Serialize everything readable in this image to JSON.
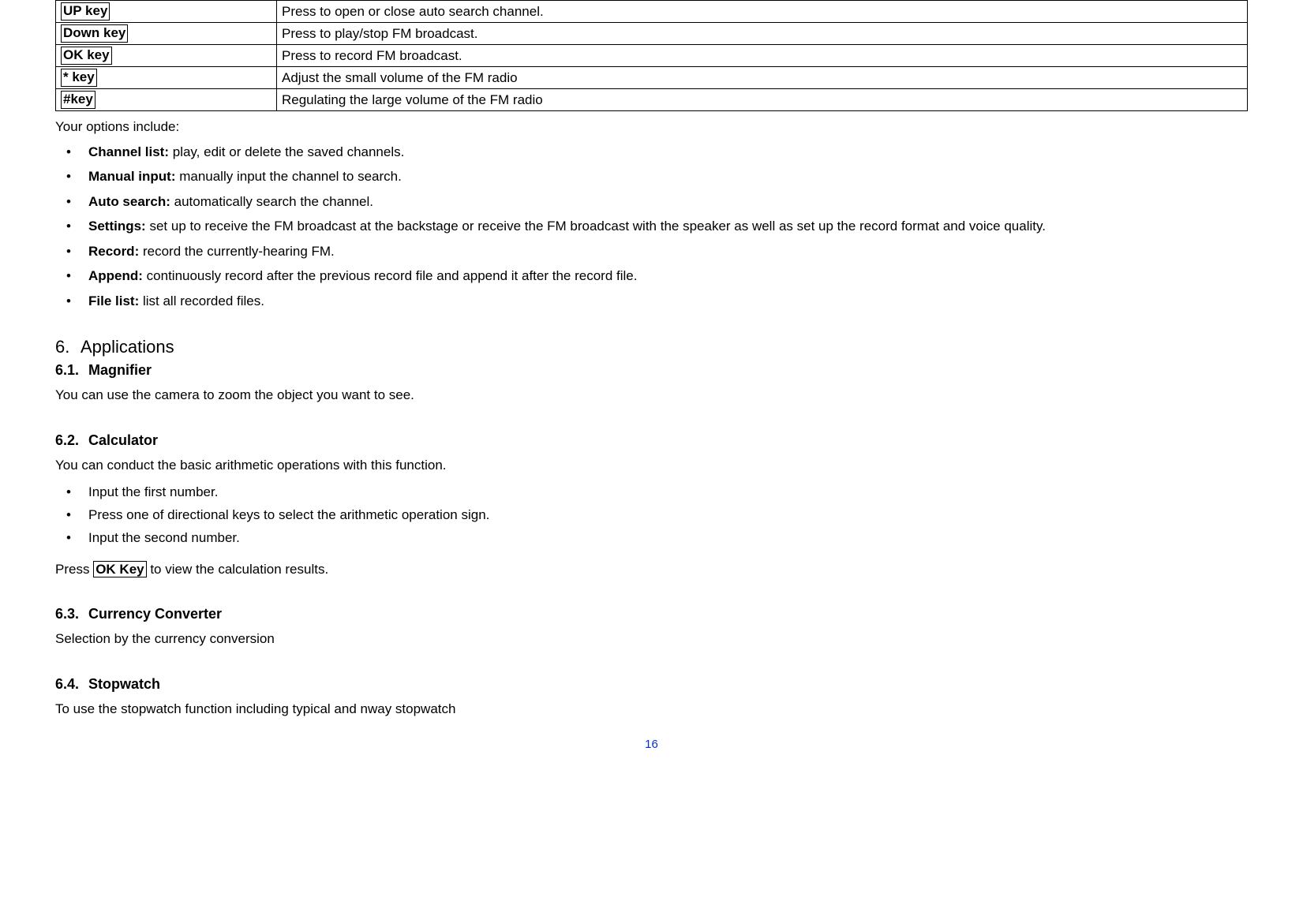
{
  "keytable": [
    {
      "key": "UP key",
      "desc": "Press to open or close auto search channel."
    },
    {
      "key": "Down key",
      "desc": "Press to play/stop FM broadcast."
    },
    {
      "key": "OK key",
      "desc": "Press to record FM broadcast."
    },
    {
      "key": "* key",
      "desc": "Adjust the small volume of the FM radio"
    },
    {
      "key": "#key",
      "desc": "Regulating the large volume of the FM radio"
    }
  ],
  "options_intro": "Your options include:",
  "options": [
    {
      "title": "Channel list:",
      "desc": " play, edit or delete the saved channels."
    },
    {
      "title": "Manual input:",
      "desc": " manually input the channel to search."
    },
    {
      "title": "Auto search:",
      "desc": " automatically search the channel."
    },
    {
      "title": "Settings:",
      "desc": " set up to receive the FM broadcast at the backstage or receive the FM broadcast with the speaker as well as set up the record format and voice quality."
    },
    {
      "title": "Record:",
      "desc": " record the currently-hearing FM."
    },
    {
      "title": "Append:",
      "desc": " continuously record after the previous record file and append it after the record file."
    },
    {
      "title": "File list:",
      "desc": " list all recorded files."
    }
  ],
  "section6": {
    "num": "6.",
    "title": "Applications"
  },
  "sub61": {
    "num": "6.1.",
    "title": "Magnifier",
    "desc": "You can use the camera to zoom the object you want to see."
  },
  "sub62": {
    "num": "6.2.",
    "title": "Calculator",
    "desc": "You can conduct the basic arithmetic operations with this function.",
    "steps": [
      "Input the first number.",
      "Press one of directional keys to select the arithmetic operation sign.",
      "Input the second number."
    ],
    "press_prefix": "Press ",
    "press_key": "OK Key",
    "press_suffix": " to view the calculation results."
  },
  "sub63": {
    "num": "6.3.",
    "title": "Currency Converter",
    "desc": "Selection by the currency conversion"
  },
  "sub64": {
    "num": "6.4.",
    "title": "Stopwatch",
    "desc": "To use the stopwatch function including typical and nway stopwatch"
  },
  "pagenum": "16"
}
